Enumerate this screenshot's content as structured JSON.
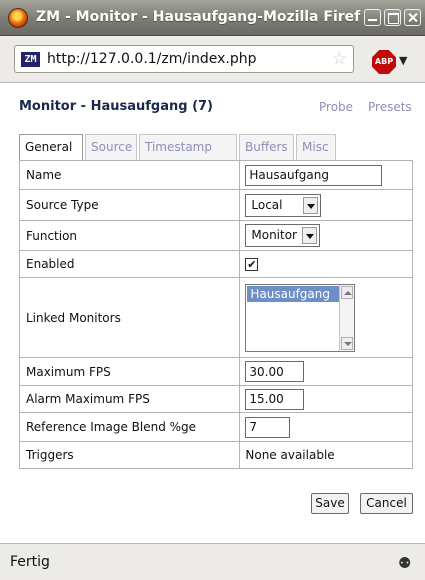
{
  "window": {
    "title": "ZM - Monitor - Hausaufgang-Mozilla Firef"
  },
  "browser": {
    "site_icon_text": "ZM",
    "url": "http://127.0.0.1/zm/index.php",
    "addon_label": "ABP",
    "status": "Fertig",
    "icons": [
      "firefox-logo-icon",
      "minimize-icon",
      "maximize-icon",
      "close-icon",
      "bookmark-star-icon",
      "adblock-plus-icon",
      "chevron-down-icon",
      "security-icon"
    ]
  },
  "page": {
    "heading": "Monitor - Hausaufgang (7)",
    "links": {
      "probe": "Probe",
      "presets": "Presets"
    },
    "tabs": [
      "General",
      "Source",
      "Timestamp",
      "Buffers",
      "Misc"
    ],
    "active_tab": "General",
    "fields": {
      "name": {
        "label": "Name",
        "value": "Hausaufgang"
      },
      "source_type": {
        "label": "Source Type",
        "value": "Local"
      },
      "function": {
        "label": "Function",
        "value": "Monitor"
      },
      "enabled": {
        "label": "Enabled",
        "checked": true,
        "mark": "✔"
      },
      "linked_monitors": {
        "label": "Linked Monitors",
        "options": [
          "Hausaufgang"
        ]
      },
      "max_fps": {
        "label": "Maximum FPS",
        "value": "30.00"
      },
      "alarm_max_fps": {
        "label": "Alarm Maximum FPS",
        "value": "15.00"
      },
      "ref_blend": {
        "label": "Reference Image Blend %ge",
        "value": "7"
      },
      "triggers": {
        "label": "Triggers",
        "value": "None available"
      }
    },
    "buttons": {
      "save": "Save",
      "cancel": "Cancel"
    }
  },
  "colors": {
    "link": "#8d8fb8",
    "heading": "#1b2a4a",
    "selection": "#6d8ec7",
    "titlebar": "#7c7c74"
  }
}
